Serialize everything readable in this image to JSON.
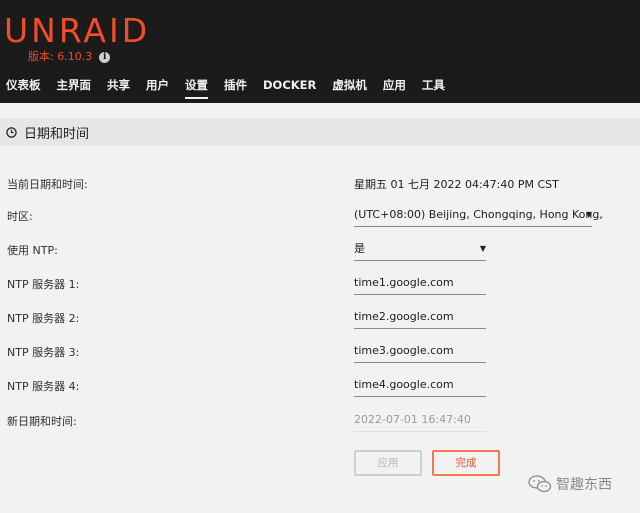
{
  "header": {
    "logo": "UNRAID",
    "version": "版本: 6.10.3",
    "nav": [
      {
        "label": "仪表板",
        "active": false
      },
      {
        "label": "主界面",
        "active": false
      },
      {
        "label": "共享",
        "active": false
      },
      {
        "label": "用户",
        "active": false
      },
      {
        "label": "设置",
        "active": true
      },
      {
        "label": "插件",
        "active": false
      },
      {
        "label": "DOCKER",
        "active": false
      },
      {
        "label": "虚拟机",
        "active": false
      },
      {
        "label": "应用",
        "active": false
      },
      {
        "label": "工具",
        "active": false
      }
    ]
  },
  "section": {
    "title": "日期和时间",
    "icon": "clock-icon"
  },
  "form": {
    "current_datetime": {
      "label": "当前日期和时间:",
      "value": "星期五 01 七月 2022 04:47:40 PM CST"
    },
    "timezone": {
      "label": "时区:",
      "value": "(UTC+08:00) Beijing, Chongqing, Hong Kong,"
    },
    "use_ntp": {
      "label": "使用 NTP:",
      "value": "是"
    },
    "ntp1": {
      "label": "NTP 服务器 1:",
      "value": "time1.google.com"
    },
    "ntp2": {
      "label": "NTP 服务器 2:",
      "value": "time2.google.com"
    },
    "ntp3": {
      "label": "NTP 服务器 3:",
      "value": "time3.google.com"
    },
    "ntp4": {
      "label": "NTP 服务器 4:",
      "value": "time4.google.com"
    },
    "new_datetime": {
      "label": "新日期和时间:",
      "value": "2022-07-01 16:47:40"
    }
  },
  "buttons": {
    "apply": "应用",
    "done": "完成"
  },
  "watermark": "智趣东西",
  "colors": {
    "accent": "#f04d2a",
    "header_bg": "#1c1b1b",
    "page_bg": "#f2f2f2",
    "done_border": "#f37a4f"
  }
}
